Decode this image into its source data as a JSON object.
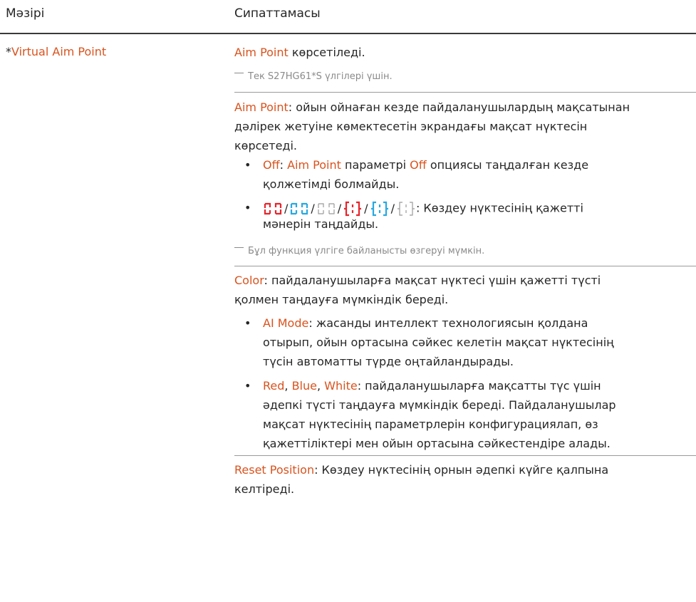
{
  "header": {
    "menu_label": "Мәзірі",
    "description_label": "Сипаттамасы"
  },
  "menu": {
    "prefix": "*",
    "name": "Virtual Aim Point"
  },
  "section1": {
    "term": "Aim Point",
    "text": " көрсетіледі.",
    "note": "Тек S27HG61*S үлгілері үшін."
  },
  "section2": {
    "term": "Aim Point",
    "line1_rest": ": ойын ойнаған кезде пайдаланушылардың мақсатынан",
    "line2": "дәлірек жетуіне көмектесетін экрандағы мақсат нүктесін",
    "line3": "көрсетеді.",
    "bullet1": {
      "term1": "Off",
      "sep1": ": ",
      "term2": "Aim Point",
      "mid": " параметрі ",
      "term3": "Off",
      "rest": " опциясы таңдалған кезде",
      "line2": "қолжетімді болмайды."
    },
    "bullet2": {
      "rest": ": Көздеу нүктесінің қажетті",
      "line2": "мәнерін таңдайды.",
      "icon_names": [
        "crosshair-red-dashed",
        "crosshair-blue-dashed",
        "crosshair-white-dashed",
        "crosshair-red-bracket",
        "crosshair-blue-bracket",
        "crosshair-white-bracket"
      ]
    },
    "note": "Бұл функция үлгіге байланысты өзгеруі мүмкін."
  },
  "section3": {
    "term": "Color",
    "line1_rest": ": пайдаланушыларға мақсат нүктесі үшін қажетті түсті",
    "line2": "қолмен таңдауға мүмкіндік береді.",
    "bullet1": {
      "term": "AI Mode",
      "rest": ": жасанды интеллект технологиясын қолдана",
      "line2": "отырып, ойын ортасына сәйкес келетін мақсат нүктесінің",
      "line3": "түсін автоматты түрде оңтайландырады."
    },
    "bullet2": {
      "term1": "Red",
      "comma1": ", ",
      "term2": "Blue",
      "comma2": ", ",
      "term3": "White",
      "rest": ": пайдаланушыларға мақсатты түс үшін",
      "line2": "әдепкі түсті таңдауға мүмкіндік береді. Пайдаланушылар",
      "line3": "мақсат нүктесінің параметрлерін конфигурациялап, өз",
      "line4": "қажеттіліктері мен ойын ортасына сәйкестендіре алады."
    }
  },
  "section4": {
    "term": "Reset Position",
    "line1_rest": ": Көздеу нүктесінің орнын әдепкі күйге қалпына",
    "line2": "келтіреді."
  },
  "colors": {
    "accent": "#d9531e",
    "aim_red": "#e8252c",
    "aim_blue": "#27a9e1",
    "aim_white": "#9a9a9a"
  }
}
